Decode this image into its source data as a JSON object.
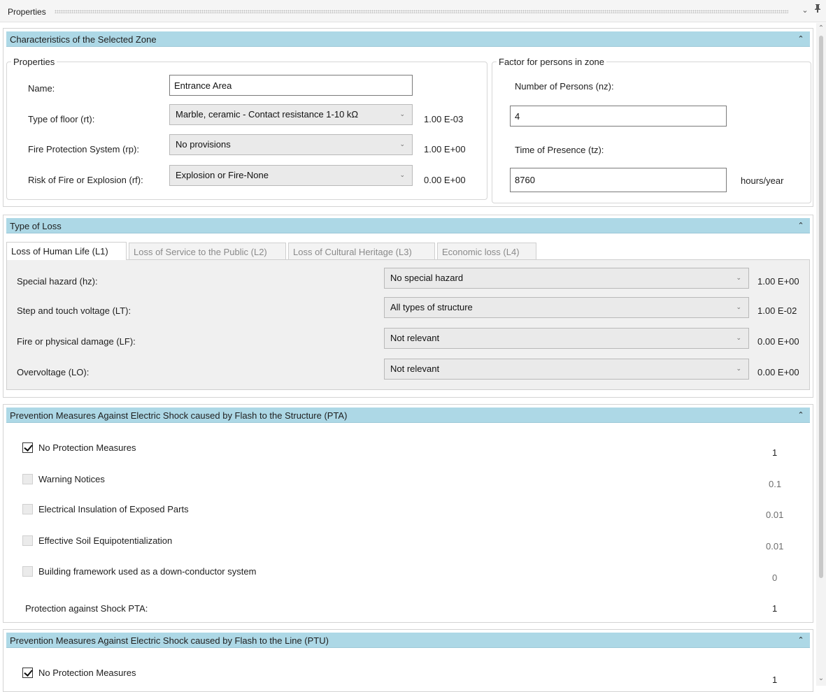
{
  "panel": {
    "title": "Properties"
  },
  "characteristics": {
    "header": "Characteristics of the Selected Zone",
    "properties_group": {
      "title": "Properties",
      "name_label": "Name:",
      "name_value": "Entrance Area",
      "floor_label": "Type of floor (rt):",
      "floor_value": "Marble, ceramic - Contact resistance 1-10 kΩ",
      "floor_factor": "1.00 E-03",
      "fire_label": "Fire Protection System (rp):",
      "fire_value": "No provisions",
      "fire_factor": "1.00 E+00",
      "risk_label": "Risk of Fire or Explosion (rf):",
      "risk_value": "Explosion or Fire-None",
      "risk_factor": "0.00 E+00"
    },
    "persons_group": {
      "title": "Factor for persons in zone",
      "number_label": "Number of Persons (nz):",
      "number_value": "4",
      "time_label": "Time of Presence (tz):",
      "time_value": "8760",
      "time_unit": "hours/year"
    }
  },
  "loss": {
    "header": "Type of Loss",
    "tabs": [
      {
        "label": "Loss of Human Life (L1)"
      },
      {
        "label": "Loss of Service to the Public (L2)"
      },
      {
        "label": "Loss of Cultural Heritage (L3)"
      },
      {
        "label": "Economic loss (L4)"
      }
    ],
    "rows": [
      {
        "label": "Special hazard (hz):",
        "value": "No special hazard",
        "factor": "1.00 E+00"
      },
      {
        "label": "Step and touch voltage (LT):",
        "value": "All types of structure",
        "factor": "1.00 E-02"
      },
      {
        "label": "Fire or physical damage (LF):",
        "value": "Not relevant",
        "factor": "0.00 E+00"
      },
      {
        "label": "Overvoltage (LO):",
        "value": "Not relevant",
        "factor": "0.00 E+00"
      }
    ]
  },
  "pta": {
    "header": "Prevention Measures Against Electric Shock caused by Flash to the Structure (PTA)",
    "items": [
      {
        "label": "No Protection Measures",
        "value": "1",
        "checked": true
      },
      {
        "label": "Warning Notices",
        "value": "0.1",
        "checked": false
      },
      {
        "label": "Electrical Insulation of Exposed Parts",
        "value": "0.01",
        "checked": false
      },
      {
        "label": "Effective Soil Equipotentialization",
        "value": "0.01",
        "checked": false
      },
      {
        "label": "Building framework used as a down-conductor system",
        "value": "0",
        "checked": false
      }
    ],
    "total_label": "Protection against Shock PTA:",
    "total_value": "1"
  },
  "ptu": {
    "header": "Prevention Measures Against Electric Shock caused by Flash to the Line (PTU)",
    "items": [
      {
        "label": "No Protection Measures",
        "value": "1",
        "checked": true
      }
    ]
  },
  "colors": {
    "section_header": "#add8e6",
    "tab_body": "#f0f0f0",
    "combo": "#eaeaea"
  }
}
